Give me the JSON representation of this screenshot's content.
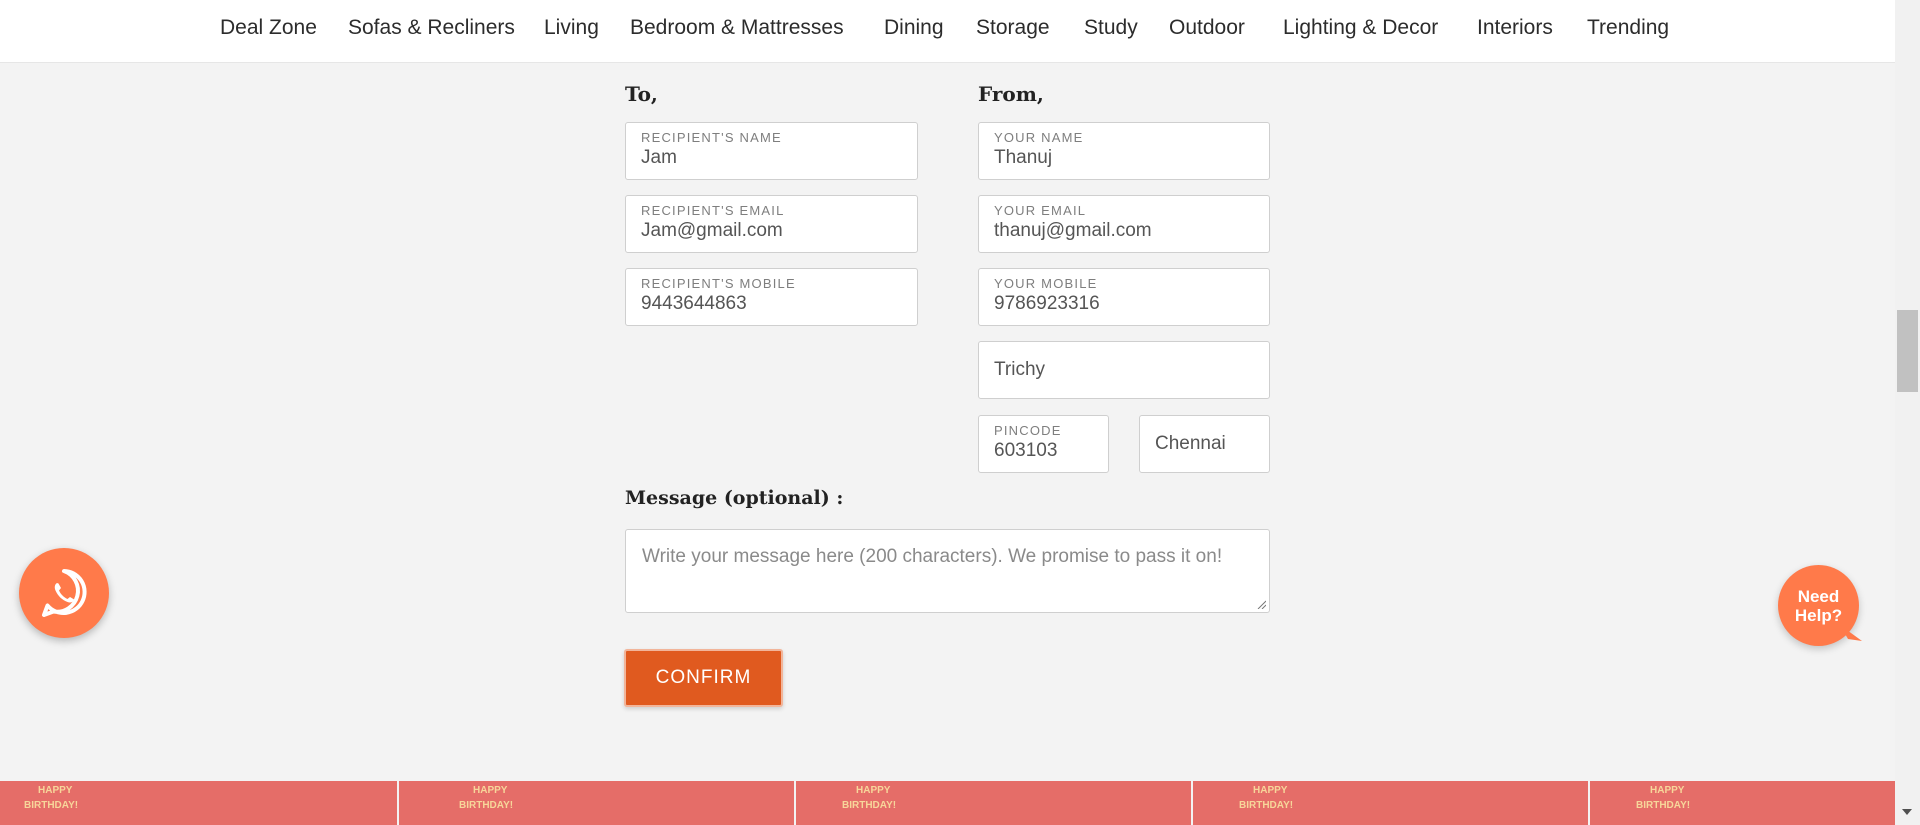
{
  "nav": {
    "items": [
      {
        "label": "Deal Zone"
      },
      {
        "label": "Sofas & Recliners"
      },
      {
        "label": "Living"
      },
      {
        "label": "Bedroom & Mattresses"
      },
      {
        "label": "Dining"
      },
      {
        "label": "Storage"
      },
      {
        "label": "Study"
      },
      {
        "label": "Outdoor"
      },
      {
        "label": "Lighting & Decor"
      },
      {
        "label": "Interiors"
      },
      {
        "label": "Trending"
      }
    ]
  },
  "form": {
    "to_title": "To,",
    "from_title": "From,",
    "recipient_name": {
      "label": "RECIPIENT'S NAME",
      "value": "Jam"
    },
    "recipient_email": {
      "label": "RECIPIENT'S EMAIL",
      "value": "Jam@gmail.com"
    },
    "recipient_mobile": {
      "label": "RECIPIENT'S MOBILE",
      "value": "9443644863"
    },
    "your_name": {
      "label": "YOUR NAME",
      "value": "Thanuj"
    },
    "your_email": {
      "label": "YOUR EMAIL",
      "value": "thanuj@gmail.com"
    },
    "your_mobile": {
      "label": "YOUR MOBILE",
      "value": "9786923316"
    },
    "address": {
      "value": "Trichy"
    },
    "pincode": {
      "label": "PINCODE",
      "value": "603103"
    },
    "city": {
      "value": "Chennai"
    },
    "message_title": "Message (optional) :",
    "message_placeholder": "Write your message here (200 characters). We promise to pass it on!",
    "confirm_label": "CONFIRM"
  },
  "banner": {
    "text_line1": "HAPPY",
    "text_line2": "BIRTHDAY!"
  },
  "help": {
    "line1": "Need",
    "line2": "Help?"
  },
  "colors": {
    "accent": "#e05a1f",
    "floating_button": "#ff7a4a",
    "banner": "#e56d68",
    "background": "#f3f3f3"
  }
}
